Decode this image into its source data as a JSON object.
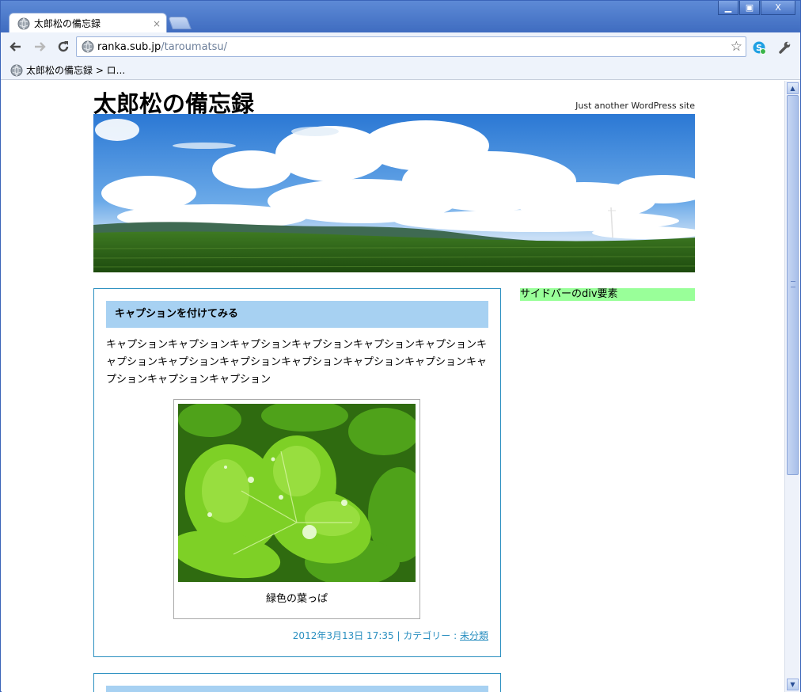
{
  "browser": {
    "tab_title": "太郎松の備忘録",
    "tab_close": "×",
    "url_host": "ranka.sub.jp",
    "url_path": "/taroumatsu/",
    "bookmark_label": "太郎松の備忘録 > ロ...",
    "window_buttons": {
      "minimize": "▁",
      "maximize": "▣",
      "close": "X"
    },
    "icons": {
      "back": "back-arrow-icon",
      "forward": "forward-arrow-icon",
      "reload": "reload-icon",
      "star": "bookmark-star-icon",
      "extension": "skype-icon",
      "wrench": "wrench-icon"
    }
  },
  "site": {
    "title": "太郎松の備忘録",
    "description": "Just another WordPress site"
  },
  "post": {
    "title": "キャプションを付けてみる",
    "body": "キャプションキャプションキャプションキャプションキャプションキャプションキャプションキャプションキャプションキャプションキャプションキャプションキャプションキャプションキャプション",
    "figure_caption": "緑色の葉っぱ",
    "meta_date": "2012年3月13日 17:35 | カテゴリー : ",
    "meta_category": "未分類"
  },
  "sidebar": {
    "text": "サイドバーのdiv要素"
  },
  "colors": {
    "accent_border": "#2a8fc0",
    "post_title_bg": "#a7d1f2",
    "sidebar_bg": "#99ff99"
  }
}
